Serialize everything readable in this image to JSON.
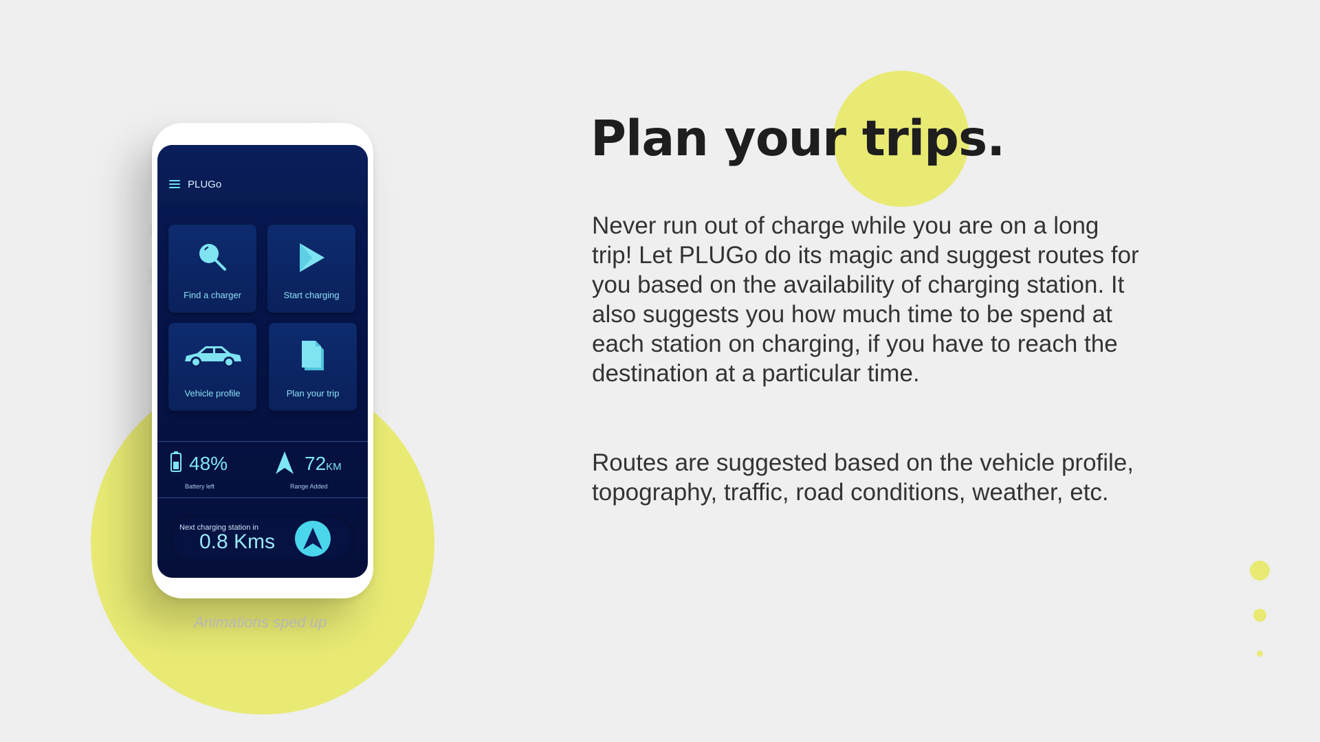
{
  "phone": {
    "app_name": "PLUGo",
    "tiles": [
      {
        "label": "Find a charger",
        "icon": "search-icon"
      },
      {
        "label": "Start charging",
        "icon": "play-icon"
      },
      {
        "label": "Vehicle profile",
        "icon": "car-icon"
      },
      {
        "label": "Plan your trip",
        "icon": "document-icon"
      }
    ],
    "battery": {
      "value": "48%",
      "caption": "Battery left",
      "icon": "battery-icon"
    },
    "range": {
      "value": "72",
      "unit": "KM",
      "caption": "Range Added",
      "icon": "navigation-arrow-icon"
    },
    "next_station": {
      "caption": "Next charging station in",
      "value": "0.8 Kms",
      "icon": "navigation-icon"
    }
  },
  "caption": "Animations sped up",
  "heading": {
    "part1": "Plan your",
    "part2": "trips."
  },
  "paragraphs": [
    "Never run out of charge while you are on a long trip! Let PLUGo do its magic and suggest routes for you based on the availability of charging station. It also suggests you how much time to be spend at each station on charging, if you have to reach the destination at a particular time.",
    "Routes are suggested based on the vehicle profile, topography, traffic, road conditions, weather, etc."
  ],
  "colors": {
    "background": "#efefef",
    "accent_yellow": "#e8ea74",
    "screen_navy": "#061347",
    "cyan": "#4ad6ec",
    "heading": "#1e1e1e"
  }
}
